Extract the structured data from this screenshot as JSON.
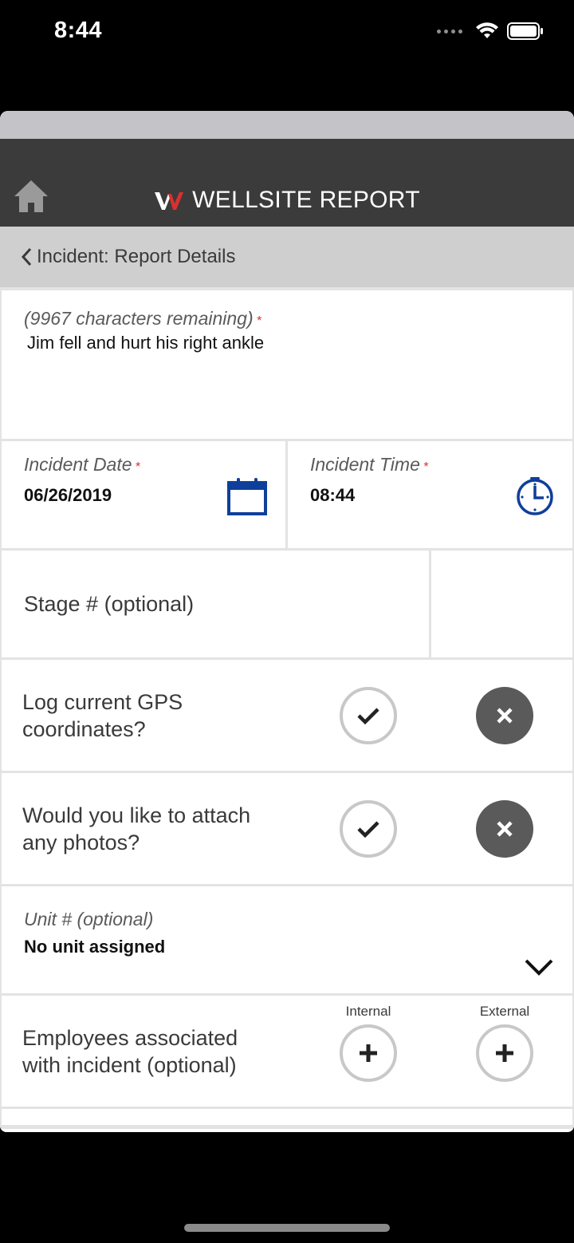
{
  "status_bar": {
    "time": "8:44"
  },
  "header": {
    "title": "WELLSITE REPORT"
  },
  "nav": {
    "title": "Incident: Report Details"
  },
  "form": {
    "notes": {
      "hint": "(9967 characters remaining)",
      "required_mark": "*",
      "value": "Jim fell and hurt his right ankle"
    },
    "incident_date": {
      "label": "Incident Date",
      "required_mark": "*",
      "value": "06/26/2019"
    },
    "incident_time": {
      "label": "Incident Time",
      "required_mark": "*",
      "value": "08:44"
    },
    "stage": {
      "label": "Stage # (optional)"
    },
    "gps": {
      "question_line1": "Log current GPS",
      "question_line2": "coordinates?"
    },
    "photos": {
      "question_line1": "Would you like to attach",
      "question_line2": "any photos?"
    },
    "unit": {
      "label": "Unit # (optional)",
      "value": "No unit assigned"
    },
    "employees": {
      "question_line1": "Employees associated",
      "question_line2": "with incident (optional)",
      "internal_label": "Internal",
      "external_label": "External"
    }
  },
  "colors": {
    "accent_blue": "#0f3f9a",
    "header_bg": "#3b3b3b",
    "required_red": "#d9302e"
  },
  "icons": [
    "home-icon",
    "logo-icon",
    "chevron-left-icon",
    "calendar-icon",
    "clock-icon",
    "check-icon",
    "close-icon",
    "chevron-down-icon",
    "plus-icon"
  ]
}
